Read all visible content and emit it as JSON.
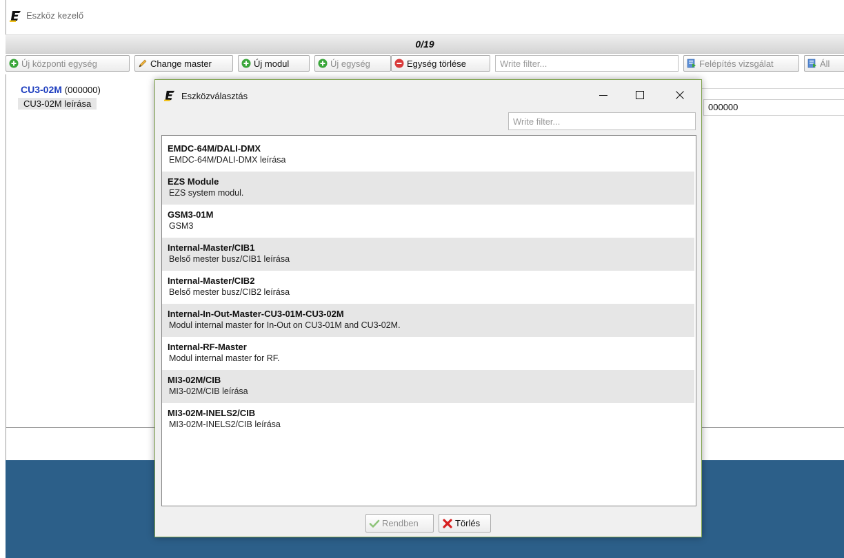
{
  "window": {
    "title": "Eszköz kezelő"
  },
  "counter": "0/19",
  "toolbar": {
    "new_central_unit": "Új központi egység",
    "change_master": "Change master",
    "new_module": "Új modul",
    "new_unit": "Új egység",
    "delete_unit": "Egység törlése",
    "filter_placeholder": "Write filter...",
    "structure_check": "Felépítés vizsgálat",
    "truncated_button": "Áll"
  },
  "tree": {
    "device_name": "CU3-02M",
    "device_code": "(000000)",
    "device_desc": "CU3-02M leírása"
  },
  "details": {
    "code_value": "000000"
  },
  "dialog": {
    "title": "Eszközválasztás",
    "filter_placeholder": "Write filter...",
    "items": [
      {
        "title": "EMDC-64M/DALI-DMX",
        "desc": "EMDC-64M/DALI-DMX leírása"
      },
      {
        "title": "EZS Module",
        "desc": "EZS system modul."
      },
      {
        "title": "GSM3-01M",
        "desc": "GSM3"
      },
      {
        "title": "Internal-Master/CIB1",
        "desc": "Belső mester busz/CIB1 leírása"
      },
      {
        "title": "Internal-Master/CIB2",
        "desc": "Belső mester busz/CIB2 leírása"
      },
      {
        "title": "Internal-In-Out-Master-CU3-01M-CU3-02M",
        "desc": "Modul internal master for In-Out on CU3-01M and CU3-02M."
      },
      {
        "title": "Internal-RF-Master",
        "desc": "Modul internal master for RF."
      },
      {
        "title": "MI3-02M/CIB",
        "desc": "MI3-02M/CIB leírása"
      },
      {
        "title": "MI3-02M-INELS2/CIB",
        "desc": "MI3-02M-INELS2/CIB leírása"
      }
    ],
    "ok_label": "Rendben",
    "cancel_label": "Törlés"
  },
  "colors": {
    "accent_blue": "#2c5f89",
    "device_name": "#1f3fbf",
    "dialog_border": "#7fa34d",
    "add_green": "#3aa63a",
    "delete_red": "#d83a3a"
  }
}
